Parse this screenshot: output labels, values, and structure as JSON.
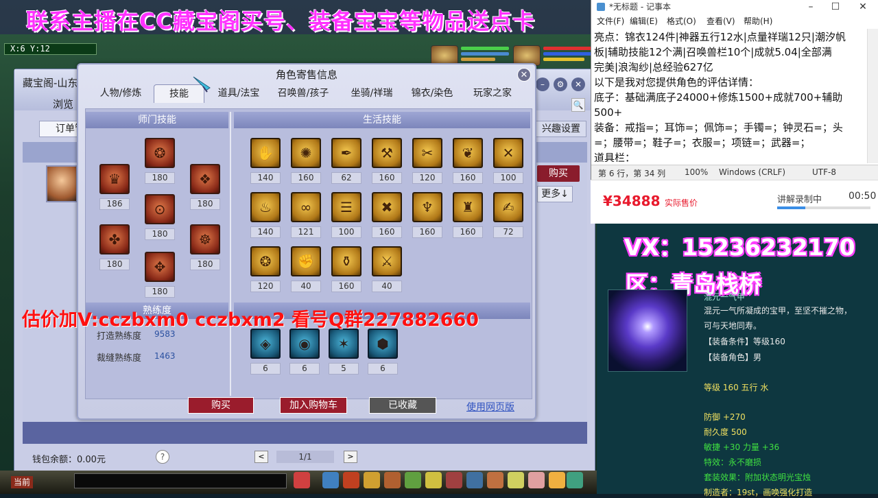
{
  "banner": {
    "text": "联系主播在CC藏宝阁买号、装备宝宝等物品送点卡"
  },
  "game": {
    "coords": "X:6  Y:12"
  },
  "cbg": {
    "title": "藏宝阁-山东",
    "browse": "浏览",
    "order_btn": "订单管",
    "interest_btn": "兴趣设置",
    "buy_btn": "购买",
    "more_btn": "更多↓",
    "wallet": "钱包余额：0.00元",
    "help": "?",
    "page": "1/1",
    "prev": "<",
    "next": ">"
  },
  "dialog": {
    "title": "角色寄售信息",
    "close": "✕",
    "tabs": [
      "人物/修炼",
      "技能",
      "道具/法宝",
      "召唤兽/孩子",
      "坐骑/祥瑞",
      "锦衣/染色",
      "玩家之家"
    ],
    "school_skills_title": "师门技能",
    "life_skills_title": "生活技能",
    "proficiency_title": "熟练度",
    "school_skills": [
      {
        "level": "180",
        "glyph": "❂"
      },
      {
        "level": "186",
        "glyph": "♛"
      },
      {
        "level": "180",
        "glyph": "❖"
      },
      {
        "level": "180",
        "glyph": "⊙"
      },
      {
        "level": "180",
        "glyph": "✤"
      },
      {
        "level": "180",
        "glyph": "☸"
      },
      {
        "level": "180",
        "glyph": "✥"
      },
      {
        "level": "180",
        "glyph": "⁂"
      }
    ],
    "life_skills": [
      {
        "level": "140",
        "glyph": "✋"
      },
      {
        "level": "160",
        "glyph": "✺"
      },
      {
        "level": "62",
        "glyph": "✒"
      },
      {
        "level": "160",
        "glyph": "⚒"
      },
      {
        "level": "120",
        "glyph": "✂"
      },
      {
        "level": "160",
        "glyph": "❦"
      },
      {
        "level": "100",
        "glyph": "✕"
      },
      {
        "level": "140",
        "glyph": "♨"
      },
      {
        "level": "121",
        "glyph": "∞"
      },
      {
        "level": "100",
        "glyph": "☰"
      },
      {
        "level": "160",
        "glyph": "✖"
      },
      {
        "level": "160",
        "glyph": "♆"
      },
      {
        "level": "160",
        "glyph": "♜"
      },
      {
        "level": "72",
        "glyph": "✍"
      },
      {
        "level": "120",
        "glyph": "❂"
      },
      {
        "level": "40",
        "glyph": "✊"
      },
      {
        "level": "160",
        "glyph": "⚱"
      },
      {
        "level": "40",
        "glyph": "⚔"
      }
    ],
    "special_skills": [
      {
        "level": "6",
        "glyph": "◈"
      },
      {
        "level": "6",
        "glyph": "◉"
      },
      {
        "level": "5",
        "glyph": "✶"
      },
      {
        "level": "6",
        "glyph": "⬢"
      }
    ],
    "proficiency": [
      {
        "label": "打造熟练度",
        "value": "9583"
      },
      {
        "label": "裁缝熟练度",
        "value": "1463"
      }
    ],
    "buy_btn": "购买",
    "cart_btn": "加入购物车",
    "collected_btn": "已收藏",
    "web_link": "使用网页版"
  },
  "overlay_red": "估价加V:cczbxm0   cczbxm2  看号Q群227882660",
  "notepad": {
    "title": "*无标题 - 记事本",
    "menu": [
      "文件(F)",
      "编辑(E)",
      "格式(O)",
      "查看(V)",
      "帮助(H)"
    ],
    "lines": [
      "亮点：锦衣124件|神器五行12水|点量祥瑞12只|潮汐帆",
      "板|辅助技能12个满|召唤兽栏10个|成就5.04|全部满",
      "完美|浪淘纱|总经验627亿",
      "以下是我对您提供角色的评估详情：",
      "底子：基础满底子24000+修炼1500+成就700+辅助",
      "500+",
      "装备：戒指=；耳饰=；佩饰=；手镯=；钟灵石=；头",
      "=；腰带=；鞋子=；衣服=；项链=；武器=；",
      "道具栏："
    ],
    "status": {
      "pos": "第 6 行，第 34 列",
      "zoom": "100%",
      "eol": "Windows (CRLF)",
      "enc": "UTF-8"
    }
  },
  "price_panel": {
    "price": "¥34888",
    "price_label": "实际售价",
    "record_label": "讲解录制中",
    "record_time": "00:50",
    "record_progress": 0.3
  },
  "overlay_right": {
    "vx": "VX：15236232170",
    "zone": "区：青岛栈桥"
  },
  "item_tooltip": {
    "name": "混元一气甲",
    "desc1": "混元一气所凝成的宝甲，至坚不摧之物，",
    "desc2": "可与天地同寿。",
    "req_level": "【装备条件】等级160",
    "req_role": "【装备角色】男",
    "level_elem": "等级 160  五行 水",
    "defense": "防御 +270",
    "durability": "耐久度 500",
    "stats": "敏捷 +30  力量 +36",
    "effect": "特效：永不磨损",
    "set": "套装效果：附加状态明光宝烛",
    "maker": "制造者：19st，画唤强化打造"
  },
  "colors": {
    "banner_magenta": "#ff30ff",
    "price_red": "#e8192c",
    "overlay_red": "#ff1010",
    "buy_button": "#8a1c2c",
    "collected_button": "#555555",
    "tooltip_yellow": "#f0e060",
    "tooltip_green": "#40e040"
  }
}
